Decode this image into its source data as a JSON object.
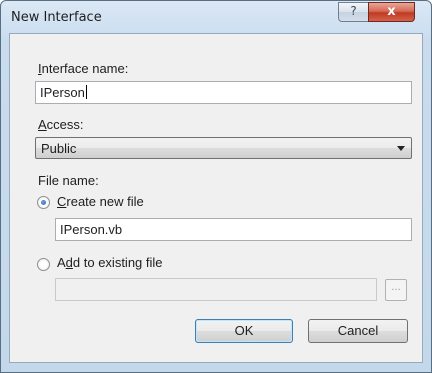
{
  "window": {
    "title": "New Interface",
    "help_glyph": "?",
    "close_glyph": "x"
  },
  "form": {
    "interface_name": {
      "label_mnemonic": "I",
      "label_rest": "nterface name:",
      "value": "IPerson"
    },
    "access": {
      "label_mnemonic": "A",
      "label_rest": "ccess:",
      "selected": "Public"
    },
    "file_name": {
      "label": "File name:"
    },
    "create_new": {
      "label_mnemonic": "C",
      "label_rest": "reate new file",
      "checked": true,
      "value": "IPerson.vb"
    },
    "add_existing": {
      "label_prefix": "A",
      "label_mnemonic": "d",
      "label_rest": "d to existing file",
      "checked": false,
      "value": "",
      "browse_label": "..."
    }
  },
  "buttons": {
    "ok": "OK",
    "cancel": "Cancel"
  }
}
